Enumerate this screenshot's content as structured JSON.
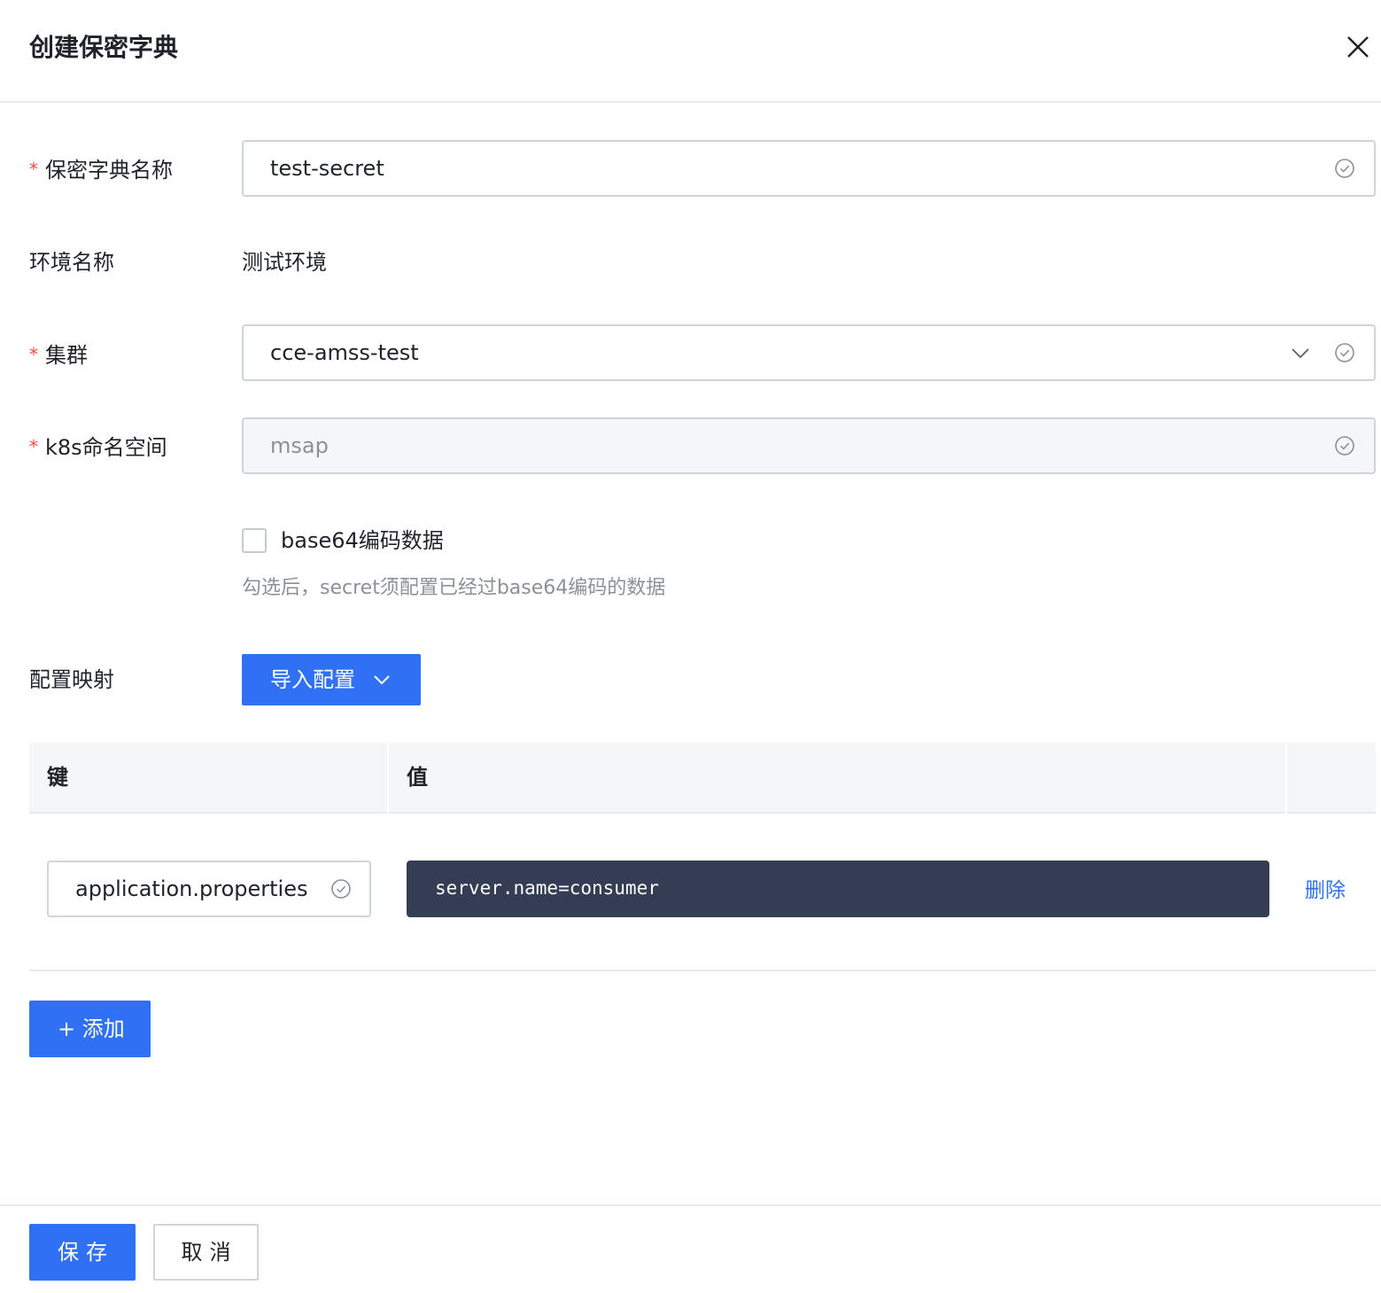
{
  "dialog": {
    "title": "创建保密字典"
  },
  "form": {
    "secret_name": {
      "label": "保密字典名称",
      "required_mark": "*",
      "value": "test-secret"
    },
    "env_name": {
      "label": "环境名称",
      "value": "测试环境"
    },
    "cluster": {
      "label": "集群",
      "required_mark": "*",
      "value": "cce-amss-test"
    },
    "namespace": {
      "label": "k8s命名空间",
      "required_mark": "*",
      "value": "msap"
    },
    "base64": {
      "label": "base64编码数据",
      "checked": false,
      "hint": "勾选后，secret须配置已经过base64编码的数据"
    },
    "config_map": {
      "label": "配置映射",
      "import_button": "导入配置"
    }
  },
  "table": {
    "headers": [
      "键",
      "值"
    ],
    "rows": [
      {
        "key": "application.properties",
        "value": "server.name=consumer",
        "action": "删除"
      }
    ],
    "add_button": "+ 添加"
  },
  "footer": {
    "save_label": "保存",
    "cancel_label": "取消"
  },
  "colors": {
    "primary": "#3070f5",
    "required": "#f54a45",
    "code_bg": "#353d55",
    "success_icon": "#8b9099"
  },
  "icons": {
    "close": "close-icon",
    "valid": "check-circle-icon",
    "dropdown": "chevron-down-icon"
  }
}
